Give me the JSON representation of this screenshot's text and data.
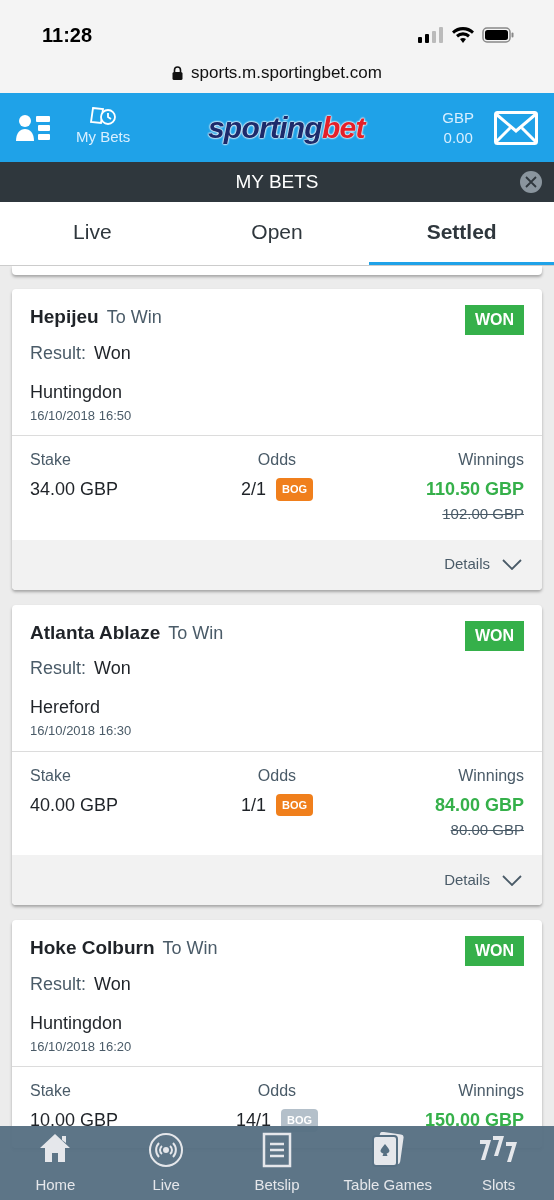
{
  "status_bar": {
    "time": "11:28"
  },
  "url_bar": {
    "url": "sports.m.sportingbet.com"
  },
  "header": {
    "my_bets_label": "My Bets",
    "logo_part_1": "sporting",
    "logo_part_2": "bet",
    "currency": "GBP",
    "balance": "0.00"
  },
  "title_bar": {
    "title": "MY BETS"
  },
  "tabs": [
    {
      "label": "Live",
      "selected": false
    },
    {
      "label": "Open",
      "selected": false
    },
    {
      "label": "Settled",
      "selected": true
    }
  ],
  "bets": [
    {
      "selection": "Hepijeu",
      "market": "To Win",
      "status": "WON",
      "result_label": "Result:",
      "result": "Won",
      "venue": "Huntingdon",
      "datetime": "16/10/2018 16:50",
      "stake_label": "Stake",
      "stake": "34.00 GBP",
      "odds_label": "Odds",
      "odds": "2/1",
      "bog": "BOG",
      "bog_active": true,
      "winnings_label": "Winnings",
      "winnings": "110.50 GBP",
      "original_winnings": "102.00 GBP",
      "details": "Details"
    },
    {
      "selection": "Atlanta Ablaze",
      "market": "To Win",
      "status": "WON",
      "result_label": "Result:",
      "result": "Won",
      "venue": "Hereford",
      "datetime": "16/10/2018 16:30",
      "stake_label": "Stake",
      "stake": "40.00 GBP",
      "odds_label": "Odds",
      "odds": "1/1",
      "bog": "BOG",
      "bog_active": true,
      "winnings_label": "Winnings",
      "winnings": "84.00 GBP",
      "original_winnings": "80.00 GBP",
      "details": "Details"
    },
    {
      "selection": "Hoke Colburn",
      "market": "To Win",
      "status": "WON",
      "result_label": "Result:",
      "result": "Won",
      "venue": "Huntingdon",
      "datetime": "16/10/2018 16:20",
      "stake_label": "Stake",
      "stake": "10.00 GBP",
      "odds_label": "Odds",
      "odds": "14/1",
      "bog": "BOG",
      "bog_active": false,
      "winnings_label": "Winnings",
      "winnings": "150.00 GBP"
    }
  ],
  "bottom_nav": [
    {
      "kind": "home",
      "label": "Home"
    },
    {
      "kind": "live",
      "label": "Live"
    },
    {
      "kind": "betslip",
      "label": "Betslip"
    },
    {
      "kind": "cards",
      "label": "Table Games"
    },
    {
      "kind": "slots",
      "label": "Slots"
    }
  ]
}
